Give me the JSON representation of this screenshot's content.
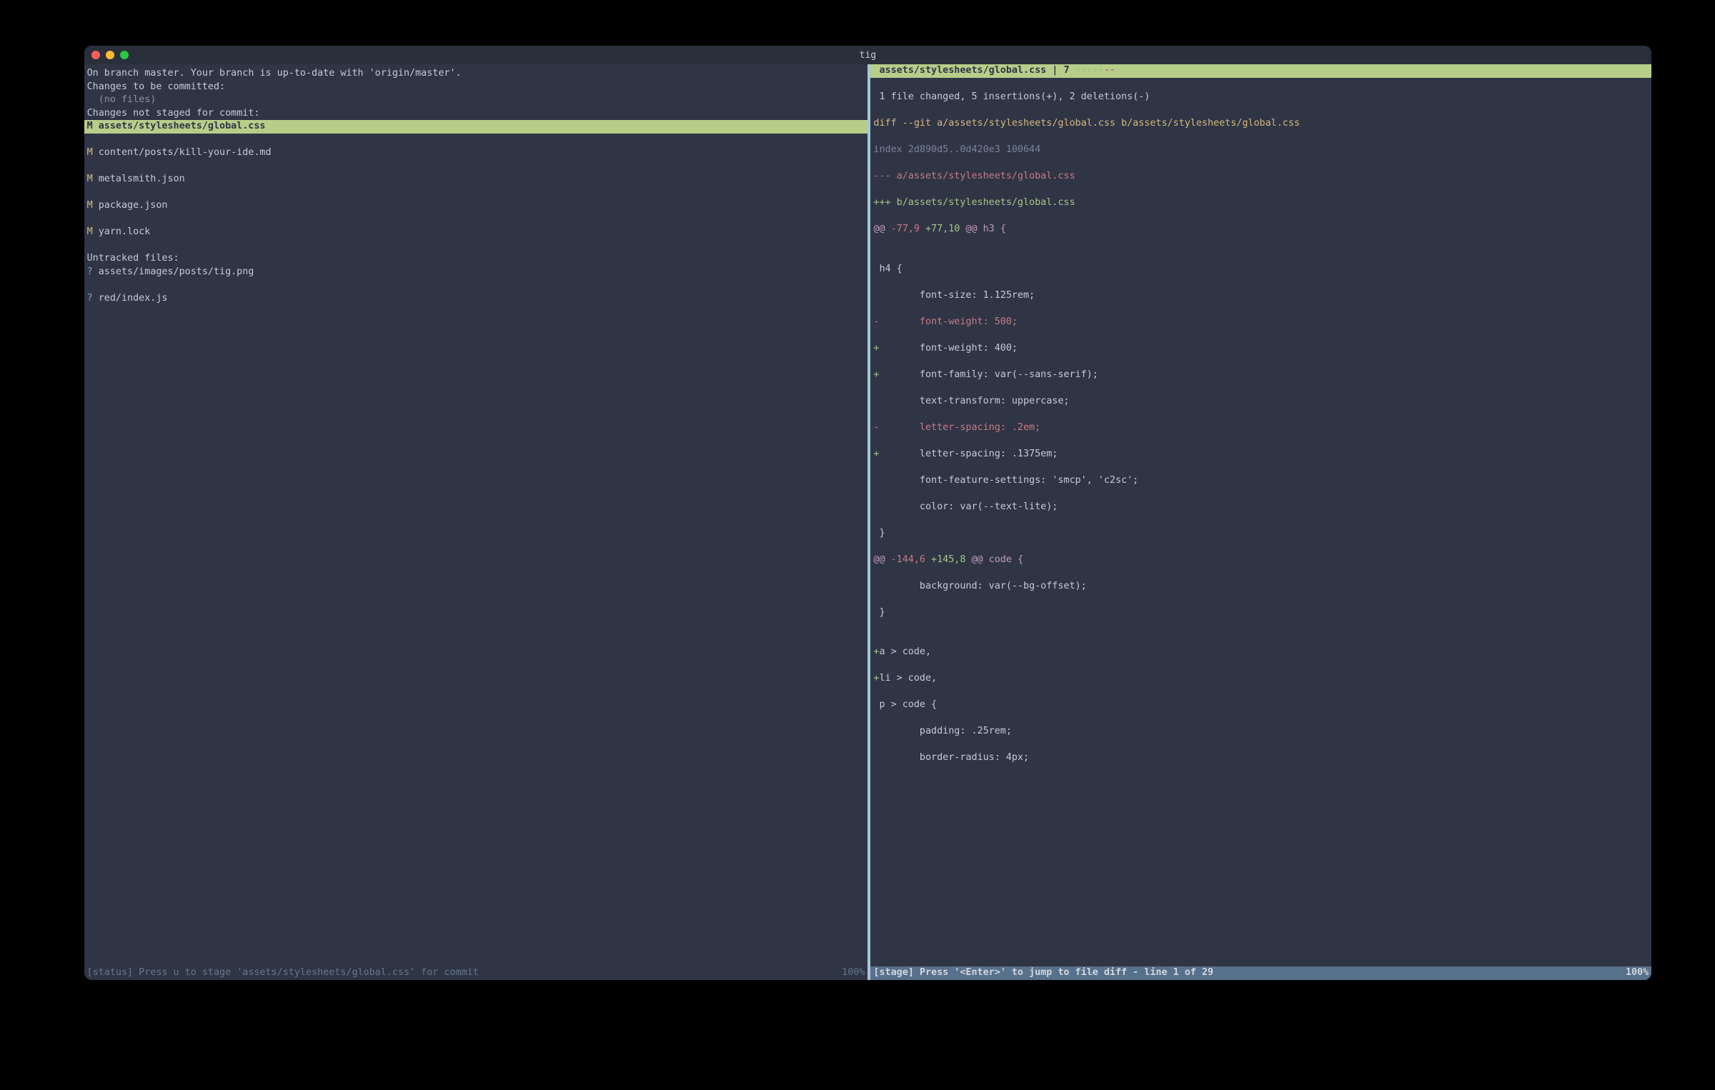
{
  "window": {
    "title": "tig"
  },
  "status_pane": {
    "branch_line": "On branch master. Your branch is up-to-date with 'origin/master'.",
    "staged_header": "Changes to be committed:",
    "staged_none": "  (no files)",
    "unstaged_header": "Changes not staged for commit:",
    "unstaged": [
      {
        "marker": "M",
        "path": "assets/stylesheets/global.css",
        "selected": true
      },
      {
        "marker": "M",
        "path": "content/posts/kill-your-ide.md",
        "selected": false
      },
      {
        "marker": "M",
        "path": "metalsmith.json",
        "selected": false
      },
      {
        "marker": "M",
        "path": "package.json",
        "selected": false
      },
      {
        "marker": "M",
        "path": "yarn.lock",
        "selected": false
      }
    ],
    "untracked_header": "Untracked files:",
    "untracked": [
      {
        "marker": "?",
        "path": "assets/images/posts/tig.png"
      },
      {
        "marker": "?",
        "path": "red/index.js"
      }
    ],
    "statusbar_left": "[status] Press u to stage 'assets/stylesheets/global.css' for commit",
    "statusbar_right": "100%"
  },
  "stage_pane": {
    "header_file": "assets/stylesheets/global.css",
    "header_sep": " | ",
    "header_stat": "7 ",
    "header_plus": "+++++",
    "header_minus": "--",
    "summary": " 1 file changed, 5 insertions(+), 2 deletions(-)",
    "diff": [
      {
        "t": "blank",
        "text": ""
      },
      {
        "t": "cmd",
        "parts": [
          {
            "c": "orange",
            "s": "diff --git "
          },
          {
            "c": "orange",
            "s": "a/assets/stylesheets/global.css b/assets/stylesheets/global.css"
          }
        ]
      },
      {
        "t": "idx",
        "parts": [
          {
            "c": "grey",
            "s": "index 2d890d5..0d420e3 100644"
          }
        ]
      },
      {
        "t": "old",
        "parts": [
          {
            "c": "red",
            "s": "--- a/assets/stylesheets/global.css"
          }
        ]
      },
      {
        "t": "new",
        "parts": [
          {
            "c": "green",
            "s": "+++ b/assets/stylesheets/global.css"
          }
        ]
      },
      {
        "t": "hunk",
        "parts": [
          {
            "c": "magenta",
            "s": "@@ "
          },
          {
            "c": "red",
            "s": "-77,9 "
          },
          {
            "c": "green",
            "s": "+77,10 "
          },
          {
            "c": "magenta",
            "s": "@@ h3 {"
          }
        ]
      },
      {
        "t": "ctx",
        "text": ""
      },
      {
        "t": "ctx",
        "text": " h4 {"
      },
      {
        "t": "ctx",
        "text": "        font-size: 1.125rem;"
      },
      {
        "t": "del",
        "sign": "-",
        "text": "       font-weight: 500;"
      },
      {
        "t": "add",
        "sign": "+",
        "text": "       font-weight: 400;"
      },
      {
        "t": "add",
        "sign": "+",
        "text": "       font-family: var(--sans-serif);"
      },
      {
        "t": "ctx",
        "text": "        text-transform: uppercase;"
      },
      {
        "t": "del",
        "sign": "-",
        "text": "       letter-spacing: .2em;"
      },
      {
        "t": "add",
        "sign": "+",
        "text": "       letter-spacing: .1375em;"
      },
      {
        "t": "ctx",
        "text": "        font-feature-settings: 'smcp', 'c2sc';"
      },
      {
        "t": "ctx",
        "text": "        color: var(--text-lite);"
      },
      {
        "t": "ctx",
        "text": " }"
      },
      {
        "t": "hunk",
        "parts": [
          {
            "c": "magenta",
            "s": "@@ "
          },
          {
            "c": "red",
            "s": "-144,6 "
          },
          {
            "c": "green",
            "s": "+145,8 "
          },
          {
            "c": "magenta",
            "s": "@@ code {"
          }
        ]
      },
      {
        "t": "ctx",
        "text": "        background: var(--bg-offset);"
      },
      {
        "t": "ctx",
        "text": " }"
      },
      {
        "t": "ctx",
        "text": ""
      },
      {
        "t": "add",
        "sign": "+",
        "text": "a > code,"
      },
      {
        "t": "add",
        "sign": "+",
        "text": "li > code,"
      },
      {
        "t": "ctx",
        "text": " p > code {"
      },
      {
        "t": "ctx",
        "text": "        padding: .25rem;"
      },
      {
        "t": "ctx",
        "text": "        border-radius: 4px;"
      }
    ],
    "statusbar_left": "[stage] Press '<Enter>' to jump to file diff - line 1 of 29",
    "statusbar_right": "100%"
  }
}
